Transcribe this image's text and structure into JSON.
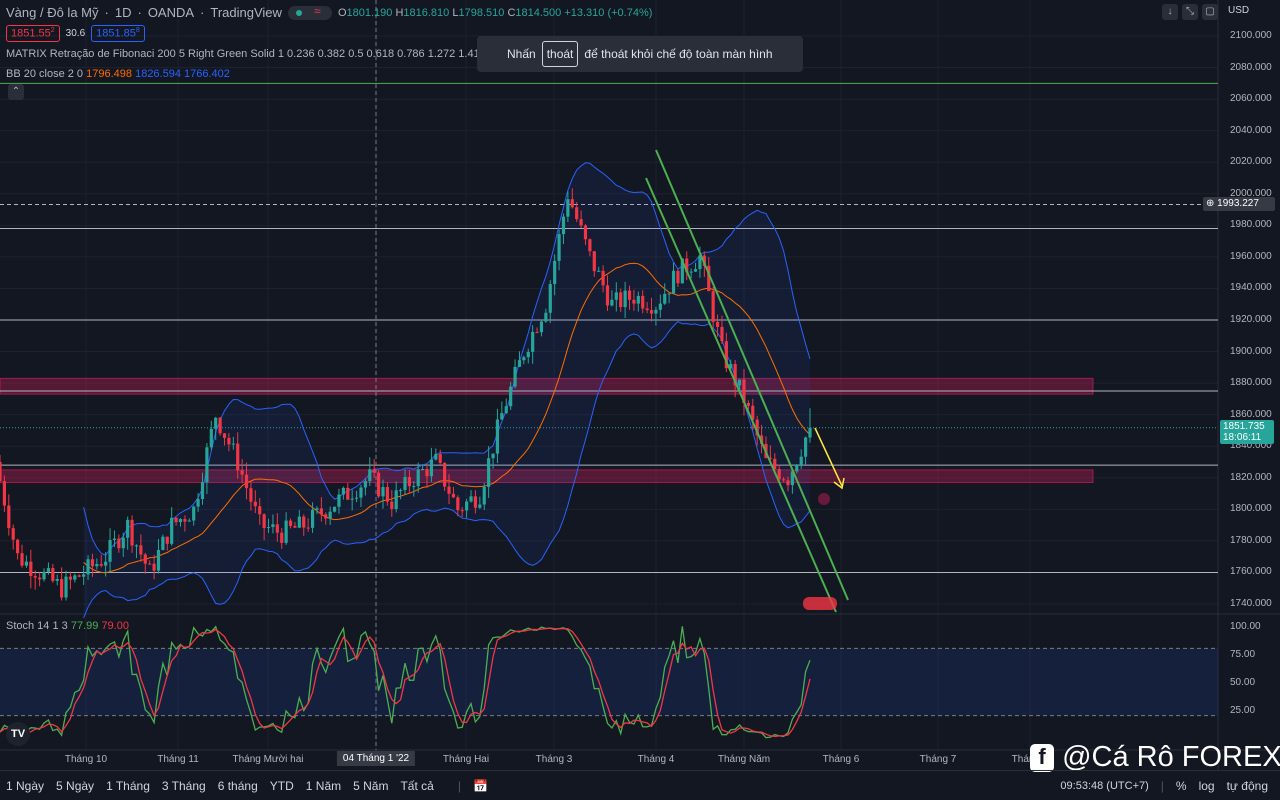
{
  "header": {
    "symbol": "Vàng / Đô la Mỹ",
    "interval": "1D",
    "broker": "OANDA",
    "source": "TradingView",
    "ohlc": {
      "o_label": "O",
      "o": "1801.190",
      "h_label": "H",
      "h": "1816.810",
      "l_label": "L",
      "l": "1798.510",
      "c_label": "C",
      "c": "1814.500",
      "change": "+13.310 (+0.74%)"
    },
    "sell_price": "1851.55",
    "sell_sup": "2",
    "spread": "30.6",
    "buy_price": "1851.85",
    "buy_sup": "8"
  },
  "indicators": {
    "fib": "MATRIX Retração de Fibonaci 200 5 Right Green Solid 1 0.236 0.382 0.5 0.618 0.786 1.272 1.414 1.618 2 Silver",
    "bb_label": "BB 20 close 2 0",
    "bb_basis": "1796.498",
    "bb_upper": "1826.594",
    "bb_lower": "1766.402",
    "stoch_label": "Stoch 14 1 3",
    "stoch_k": "77.99",
    "stoch_d": "79.00"
  },
  "toast": {
    "pre": "Nhấn",
    "key": "thoát",
    "post": "để thoát khỏi chế độ toàn màn hình"
  },
  "currency": "USD",
  "price_axis": [
    "2100.000",
    "2080.000",
    "2060.000",
    "2040.000",
    "2020.000",
    "2000.000",
    "1980.000",
    "1960.000",
    "1940.000",
    "1920.000",
    "1900.000",
    "1880.000",
    "1860.000",
    "1840.000",
    "1820.000",
    "1800.000",
    "1780.000",
    "1760.000",
    "1740.000"
  ],
  "stoch_axis": [
    "100.00",
    "75.00",
    "50.00",
    "25.00"
  ],
  "last_price": "1851.735",
  "countdown": "18:06:11",
  "crosshair_price": "1993.227",
  "time_axis": [
    "Tháng 10",
    "Tháng 11",
    "Tháng Mười hai",
    "04 Tháng 1 '22",
    "Tháng Hai",
    "Tháng 3",
    "Tháng 4",
    "Tháng Năm",
    "Tháng 6",
    "Tháng 7",
    "Tháng 8"
  ],
  "ranges": [
    "1 Ngày",
    "5 Ngày",
    "1 Tháng",
    "3 Tháng",
    "6 tháng",
    "YTD",
    "1 Năm",
    "5 Năm",
    "Tất cả"
  ],
  "clock": "09:53:48 (UTC+7)",
  "footer_opts": [
    "%",
    "log",
    "tự động"
  ],
  "watermark": "@Cá Rô FOREX",
  "colors": {
    "up": "#26a69a",
    "down": "#f23645",
    "bb": "#2962ff",
    "basis": "#ff6d00",
    "zone": "#e91e63",
    "channel": "#4caf50",
    "arrow": "#ffeb3b"
  },
  "chart_data": {
    "type": "candlestick",
    "title": "Vàng / Đô la Mỹ 1D OANDA",
    "ylim": [
      1740,
      2100
    ],
    "weekly_closes": [
      1830,
      1770,
      1760,
      1750,
      1760,
      1770,
      1790,
      1760,
      1790,
      1800,
      1860,
      1830,
      1790,
      1785,
      1790,
      1800,
      1810,
      1820,
      1805,
      1820,
      1830,
      1800,
      1810,
      1860,
      1900,
      1930,
      2000,
      1960,
      1930,
      1935,
      1930,
      1950,
      1960,
      1900,
      1870,
      1830,
      1820,
      1851.7
    ],
    "levels": [
      2070,
      1993.227,
      1978,
      1920,
      1875,
      1828,
      1760
    ],
    "zones": [
      [
        1873,
        1883
      ],
      [
        1817,
        1825
      ]
    ]
  }
}
